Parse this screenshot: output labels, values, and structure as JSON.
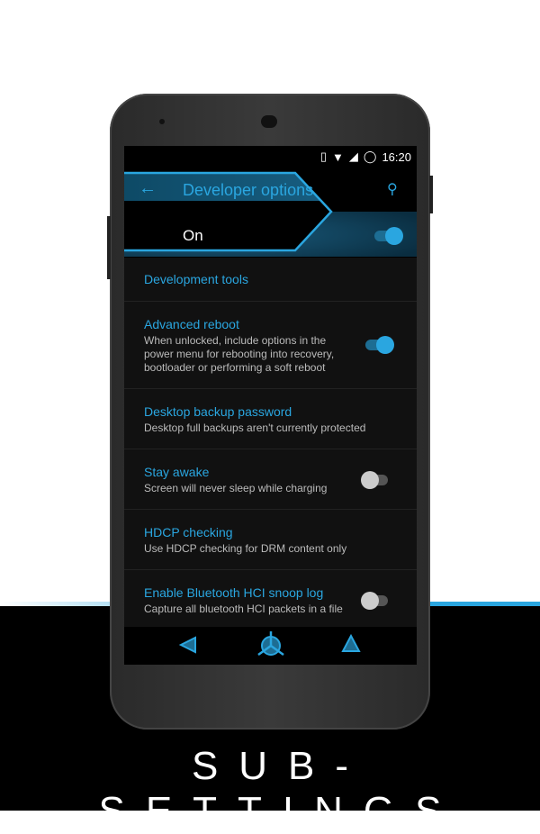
{
  "status": {
    "time": "16:20"
  },
  "appbar": {
    "title": "Developer options",
    "master_label": "On",
    "master_on": true
  },
  "items": [
    {
      "title": "Development tools"
    },
    {
      "title": "Advanced reboot",
      "summary": "When unlocked, include options in the power menu for rebooting into recovery, bootloader or performing a soft reboot",
      "on": true
    },
    {
      "title": "Desktop backup password",
      "summary": "Desktop full backups aren't currently protected"
    },
    {
      "title": "Stay awake",
      "summary": "Screen will never sleep while charging",
      "on": false
    },
    {
      "title": "HDCP checking",
      "summary": "Use HDCP checking for DRM content only"
    },
    {
      "title": "Enable Bluetooth HCI snoop log",
      "summary": "Capture all bluetooth HCI packets in a file",
      "on": false
    }
  ],
  "caption": "SUB-SETTINGS",
  "colors": {
    "accent": "#2aa6e0",
    "background": "#111111"
  }
}
